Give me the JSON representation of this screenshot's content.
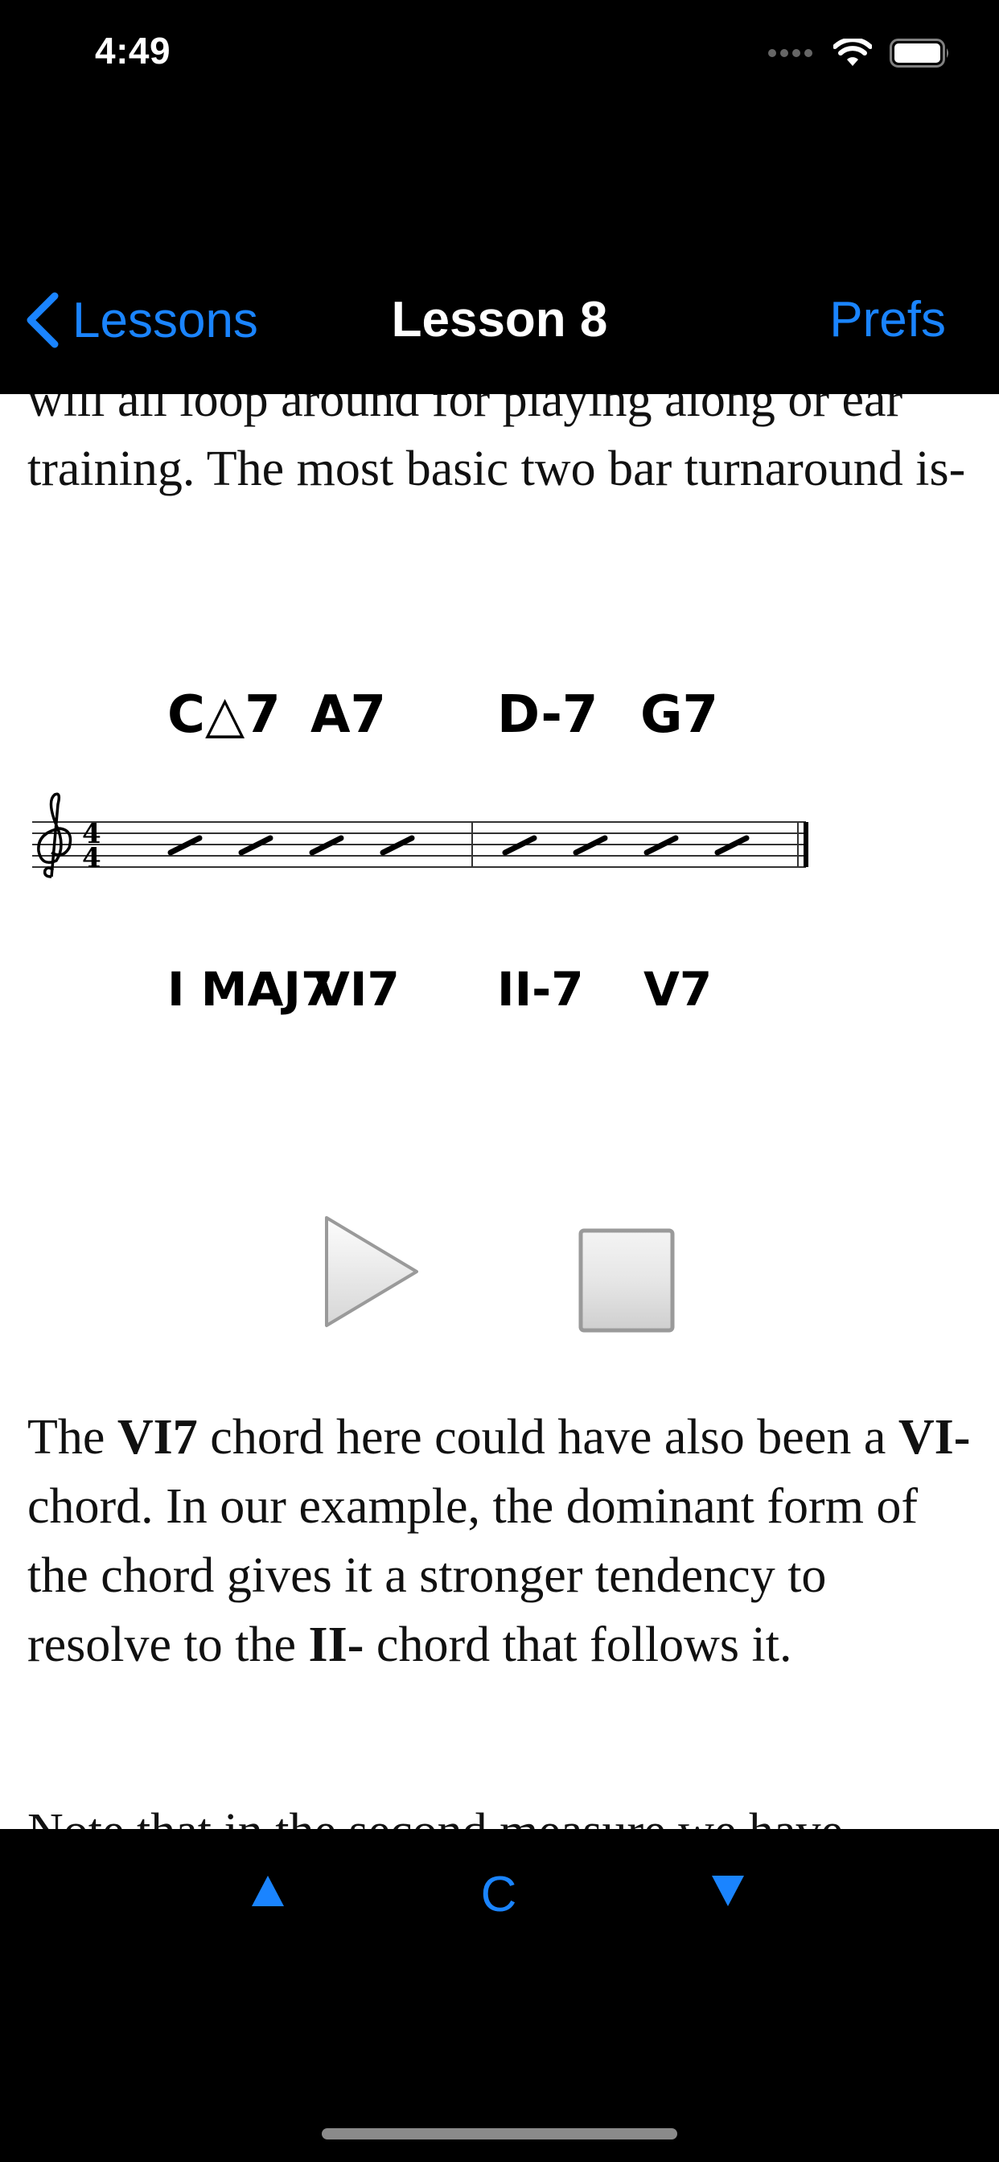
{
  "status_bar": {
    "time": "4:49"
  },
  "nav": {
    "back_label": "Lessons",
    "title": "Lesson 8",
    "prefs_label": "Prefs"
  },
  "content": {
    "paragraph_1": "will all loop around for playing along or ear training. The most basic two bar turnaround is-",
    "paragraph_2_parts": [
      "The ",
      "VI7",
      " chord here could have also been a ",
      "VI-",
      " chord. In our example, the dominant form of the chord gives it a stronger tendency to resolve to the ",
      "II-",
      " chord that follows it."
    ],
    "paragraph_3": "Note that in the second measure we have",
    "sheet": {
      "chord_symbols": [
        "C△7",
        "A7",
        "D-7",
        "G7"
      ],
      "roman_numerals": [
        "I MAJ7",
        "VI7",
        "II-7",
        "V7"
      ],
      "time_signature": [
        "4",
        "4"
      ]
    }
  },
  "toolbar": {
    "up_icon": "triangle-up-icon",
    "center_label": "C",
    "down_icon": "triangle-down-icon"
  },
  "colors": {
    "accent": "#1A84FF",
    "background": "#000000",
    "page": "#FFFFFF"
  }
}
